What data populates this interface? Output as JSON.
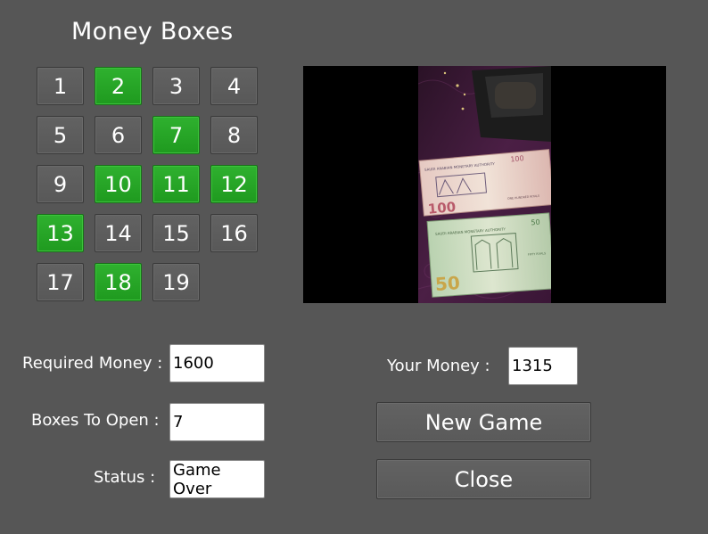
{
  "title": "Money Boxes",
  "boxes": [
    {
      "label": "1",
      "open": false
    },
    {
      "label": "2",
      "open": true
    },
    {
      "label": "3",
      "open": false
    },
    {
      "label": "4",
      "open": false
    },
    {
      "label": "5",
      "open": false
    },
    {
      "label": "6",
      "open": false
    },
    {
      "label": "7",
      "open": true
    },
    {
      "label": "8",
      "open": false
    },
    {
      "label": "9",
      "open": false
    },
    {
      "label": "10",
      "open": true
    },
    {
      "label": "11",
      "open": true
    },
    {
      "label": "12",
      "open": true
    },
    {
      "label": "13",
      "open": true
    },
    {
      "label": "14",
      "open": false
    },
    {
      "label": "15",
      "open": false
    },
    {
      "label": "16",
      "open": false
    },
    {
      "label": "17",
      "open": false
    },
    {
      "label": "18",
      "open": true
    },
    {
      "label": "19",
      "open": false
    }
  ],
  "required_money": {
    "label": "Required Money :",
    "value": "1600"
  },
  "boxes_to_open": {
    "label": "Boxes To Open :",
    "value": "7"
  },
  "status": {
    "label": "Status :",
    "value": "Game Over"
  },
  "your_money": {
    "label": "Your Money :",
    "value": "1315"
  },
  "buttons": {
    "new_game": "New Game",
    "close": "Close"
  },
  "photo": {
    "note_100_digits": "100",
    "note_50_digits": "50",
    "note_100_text": "ONE HUNDRED RIYALS",
    "note_50_text": "FIFTY RIYALS",
    "bank_text": "SAUDI ARABIAN MONETARY AUTHORITY"
  },
  "colors": {
    "background": "#565656",
    "box_open": "#26a526",
    "box_closed": "#5e5e5e"
  }
}
